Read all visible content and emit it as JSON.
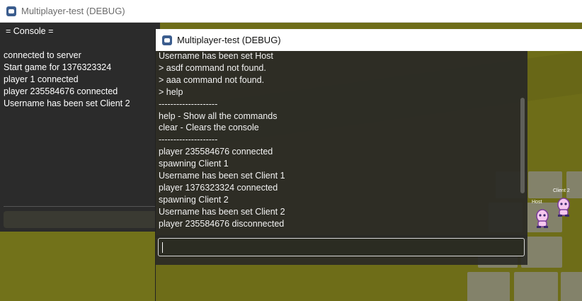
{
  "window_back": {
    "title": "Multiplayer-test (DEBUG)",
    "console_header": "= Console =",
    "console_lines": [
      "connected to server",
      "Start game for  1376323324",
      "player 1 connected",
      "player 235584676 connected",
      "Username has been set Client 2"
    ]
  },
  "window_front": {
    "title": "Multiplayer-test (DEBUG)",
    "console_lines": [
      "Username has been set Host",
      "> asdf command not found.",
      "> aaa command not found.",
      "> help",
      "--------------------",
      "help - Show all the commands",
      "clear - Clears the console",
      "--------------------",
      "player 235584676 connected",
      "spawning Client 1",
      "Username has been set Client 1",
      "player 1376323324 connected",
      "spawning Client 2",
      "Username has been set Client 2",
      "player 235584676 disconnected"
    ],
    "input_value": ""
  },
  "players": {
    "host_label": "Host",
    "client_label": "Client 2"
  },
  "icons": {
    "app": "godot-icon"
  },
  "colors": {
    "ground": "#6e6d18",
    "console_bg": "#2b2b2b",
    "titlebar_bg": "#ffffff",
    "player_body": "#f6c7ee"
  }
}
